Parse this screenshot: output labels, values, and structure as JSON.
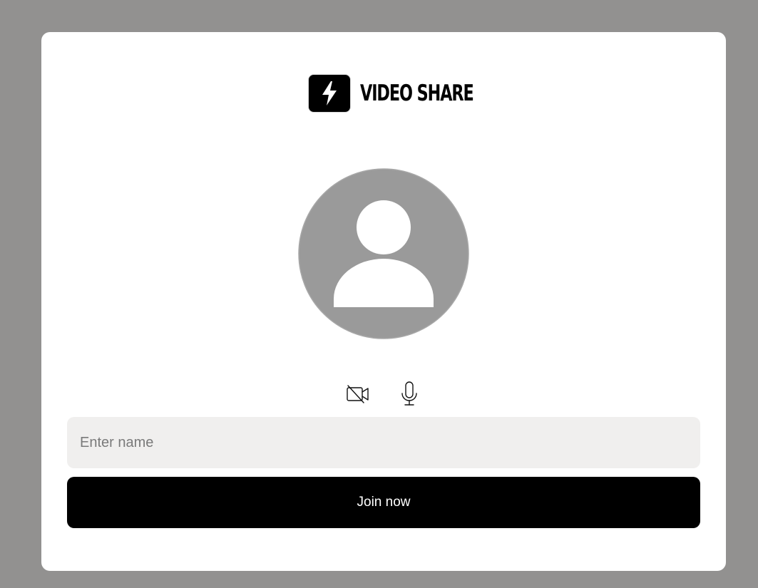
{
  "brand": {
    "name": "VIDEO SHARE",
    "logo_icon": "lightning-bolt-icon"
  },
  "avatar": {
    "icon": "user-placeholder-icon",
    "color": "#9a9a9a"
  },
  "media_controls": {
    "camera_icon": "video-camera-off-icon",
    "microphone_icon": "microphone-icon"
  },
  "form": {
    "name_placeholder": "Enter name",
    "name_value": "",
    "join_label": "Join now"
  },
  "colors": {
    "backdrop": "#929190",
    "card": "#ffffff",
    "input_background": "#f0efee",
    "primary_button": "#000000"
  }
}
